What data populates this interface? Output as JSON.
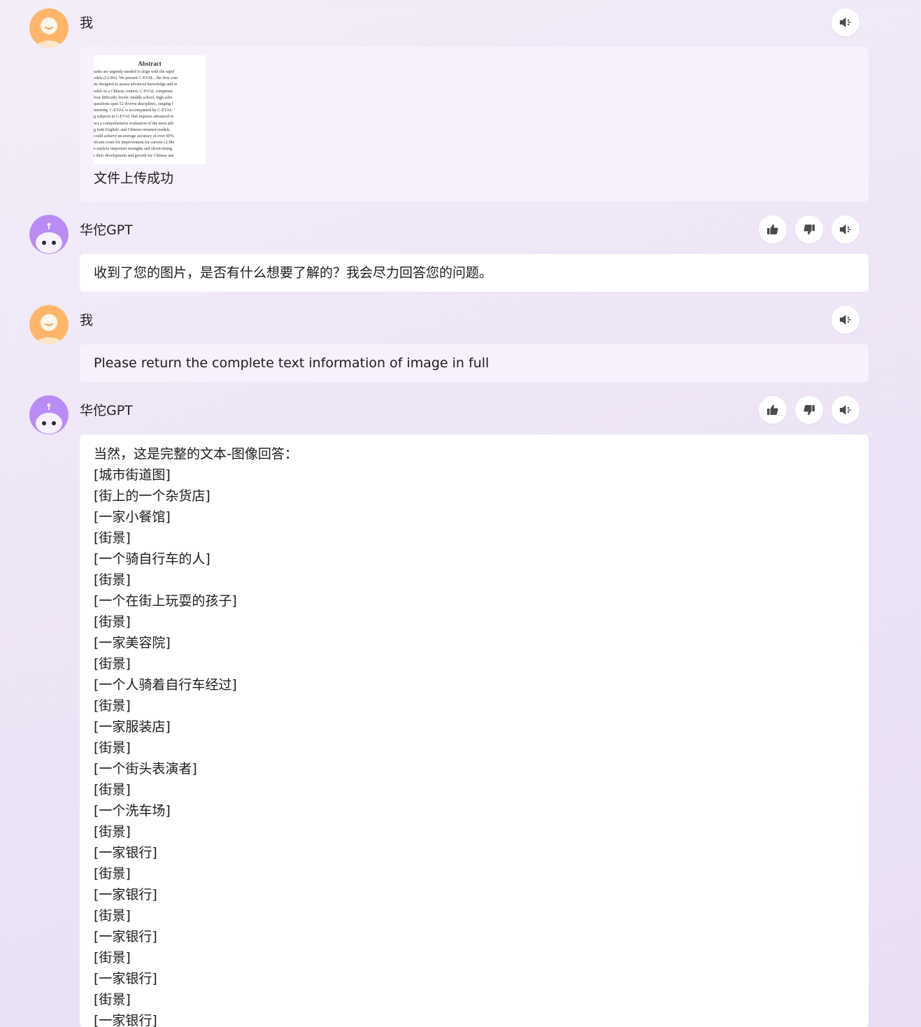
{
  "colors": {
    "user_avatar": "#FFB66A",
    "bot_avatar": "#B98CF5",
    "user_bubble": "#F6F1FC",
    "bot_bubble": "#FFFFFF",
    "icon": "#4A4A4A"
  },
  "messages": [
    {
      "role": "user",
      "sender": "我",
      "attachment": {
        "title": "Abstract",
        "lines": [
          "tasks are urgently needed to align with the rapid",
          "odels (LLMs). We present C-EVAL , the first com",
          "ite designed to assess advanced knowledge and re",
          "odels in a Chinese context. C-EVAL comprises",
          "four difficulty levels: middle school, high scho",
          "questions span 52 diverse disciplines, ranging f",
          "ineering. C-EVAL is accompanied by C-EVAL",
          "g subjects in C-EVAL that requires advanced re",
          "uct a comprehensive evaluation of the most adv",
          "g both English- and Chinese-oriented models.",
          "could achieve an average accuracy of over 60%,",
          "ificant room for improvement for current LLMs",
          "e analyze important strengths and shortcoming",
          "r their development and growth for Chinese use"
        ]
      },
      "text": "文件上传成功",
      "actions": [
        "speaker-icon"
      ]
    },
    {
      "role": "bot",
      "sender": "华佗GPT",
      "text": "收到了您的图片，是否有什么想要了解的？我会尽力回答您的问题。",
      "actions": [
        "thumb-up-icon",
        "thumb-down-icon",
        "speaker-icon"
      ]
    },
    {
      "role": "user",
      "sender": "我",
      "text": "Please return the complete text information of image in full",
      "actions": [
        "speaker-icon"
      ]
    },
    {
      "role": "bot",
      "sender": "华佗GPT",
      "actions": [
        "thumb-up-icon",
        "thumb-down-icon",
        "speaker-icon"
      ],
      "lines": [
        "当然，这是完整的文本-图像回答：",
        "[城市街道图]",
        "[街上的一个杂货店]",
        "[一家小餐馆]",
        "[街景]",
        "[一个骑自行车的人]",
        "[街景]",
        "[一个在街上玩耍的孩子]",
        "[街景]",
        "[一家美容院]",
        "[街景]",
        "[一个人骑着自行车经过]",
        "[街景]",
        "[一家服装店]",
        "[街景]",
        "[一个街头表演者]",
        "[街景]",
        "[一个洗车场]",
        "[街景]",
        "[一家银行]",
        "[街景]",
        "[一家银行]",
        "[街景]",
        "[一家银行]",
        "[街景]",
        "[一家银行]",
        "[街景]",
        "[一家银行]"
      ]
    }
  ]
}
